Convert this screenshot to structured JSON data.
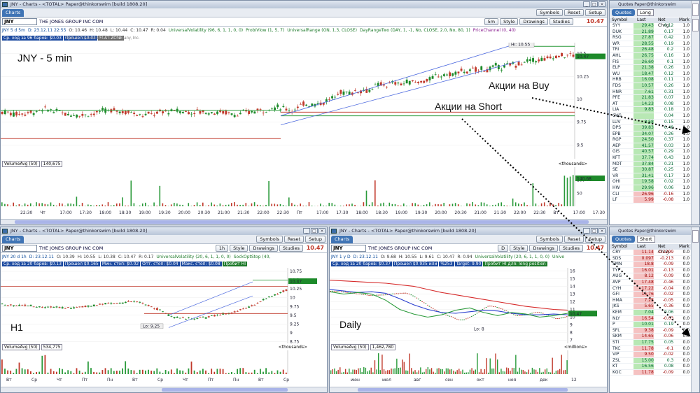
{
  "main_chart": {
    "window_title": "JNY - Charts - <TOTAL> Paper@thinkorswim [build 1808.20]",
    "tab": "Charts",
    "symbol": "JNY",
    "company": "THE JONES GROUP INC COM",
    "last_price": "10.47",
    "change": "+0.32%",
    "toolbar": {
      "symbols": "Symbols",
      "reset": "Reset",
      "setup": "Setup"
    },
    "chart_controls": {
      "timeframe": "5m",
      "style": "Style",
      "drawings": "Drawings",
      "studies": "Studies"
    },
    "studies": [
      "JNY 5 d 5m",
      "D: 23.12.11 22:55",
      "O: 10.46",
      "H: 10.48",
      "L: 10.44",
      "C: 10.47",
      "R: 0.04",
      "UniversalVolatility (96, 6, 1, 1, 0, 0)",
      "ProbIVlow (1, 5, 7)",
      "UniversalRange (ON, 1.3, CLOSE)",
      "DayRangeTwo (DAY, 1, -1, No, CLOSE, 2.0, No, 80, 1)",
      "PriceChannel (0, 40)"
    ],
    "info_badges": [
      "Ср. ход за 96 баров: $0.03",
      "Прошел $0.04",
      "FLAT ZONE"
    ],
    "copyright": "2011 © TD Ameritrade IP Company, Inc.",
    "annotation": "JNY - 5 min",
    "callout_buy": "Акции на Buy",
    "callout_short": "Акции на Short",
    "hi_label": "Hi: 10.55",
    "price_axis": [
      "10.5",
      "10.25",
      "10",
      "9.75",
      "9.5"
    ],
    "price_tag": "10.47",
    "volume_header": "VolumeAvg (50)",
    "volume_value": "140,675",
    "volume_units": "<thousands>",
    "volume_axis": [
      "100",
      "50"
    ],
    "volume_tag": "140.68",
    "time_axis": [
      "22:30",
      "Чт",
      "17:00",
      "17:30",
      "18:00",
      "18:30",
      "19:00",
      "19:30",
      "20:00",
      "20:30",
      "21:00",
      "21:30",
      "22:00",
      "22:30",
      "Пт",
      "17:00",
      "17:30",
      "18:00",
      "18:30",
      "19:00",
      "19:30",
      "20:00",
      "20:30",
      "21:00",
      "21:30",
      "22:00",
      "22:30",
      "Вт",
      "17:00",
      "17:30"
    ]
  },
  "h1_chart": {
    "window_title": "JNY - Charts - <TOTAL> Paper@thinkorswim [build 1808.20]",
    "tab": "Charts",
    "symbol": "JNY",
    "company": "THE JONES GROUP INC COM",
    "last_price": "10.47",
    "toolbar": {
      "symbols": "Symbols",
      "reset": "Reset",
      "setup": "Setup"
    },
    "chart_controls": {
      "timeframe": "1h",
      "style": "Style",
      "drawings": "Drawings",
      "studies": "Studies"
    },
    "studies": [
      "JNY 20 d 1h",
      "D: 23.12.11",
      "O: 10.39",
      "H: 10.55",
      "L: 10.38",
      "C: 10.47",
      "R: 0.17",
      "UniversalVolatility (20, 6, 1, 1, 0, 0)",
      "SockOptStop (40,"
    ],
    "info_badges": [
      "Ср. ход за 20 баров: $0.13",
      "Прошел $0.165",
      "Мин. стоп: $0.02",
      "Опт. стоп: $0.04",
      "Макс. стоп: $0.08",
      "Пробит HI"
    ],
    "annotation": "H1",
    "lo_label": "Lo: 9.25",
    "price_axis": [
      "10.75",
      "10.5",
      "10.25",
      "10",
      "9.75",
      "9.5",
      "9.25",
      "9",
      "8.75"
    ],
    "price_tag": "10.47",
    "volume_header": "VolumeAvg (50)",
    "volume_value": "534,775",
    "volume_units": "<thousands>",
    "time_axis": [
      "Вт",
      "Ср",
      "Чт",
      "Пт",
      "Пн",
      "Вт",
      "Ср",
      "Чт",
      "Пт",
      "Пн",
      "Вт",
      "Ср"
    ]
  },
  "daily_chart": {
    "window_title": "JNY - Charts - <TOTAL> Paper@thinkorswim [build 1808.20]",
    "tab": "Charts",
    "symbol": "JNY",
    "company": "THE JONES GROUP INC COM",
    "last_price": "10.47",
    "toolbar": {
      "symbols": "Symbols",
      "reset": "Reset",
      "setup": "Setup"
    },
    "chart_controls": {
      "timeframe": "D",
      "style": "Style",
      "drawings": "Drawings",
      "studies": "Studies"
    },
    "studies": [
      "JNY 1 y D",
      "D: 23.12.11",
      "O: 9.68",
      "H: 10.55",
      "L: 9.61",
      "C: 10.47",
      "R: 0.94",
      "UniversalVolatility (20, 6, 1, 1, 0, 0)",
      "Unive"
    ],
    "info_badges": [
      "Ср. ход за 20 баров: $0.37",
      "Прошел $0.935 или",
      "%253",
      "Target: 9.90",
      "Пробит HI для: long position"
    ],
    "annotation": "Daily",
    "lo_label": "Lo: 8",
    "price_axis": [
      "16",
      "15",
      "14",
      "13",
      "12",
      "11",
      "10",
      "9",
      "8",
      "7"
    ],
    "price_tag": "10.47",
    "volume_header": "VolumeAvg (50)",
    "volume_value": "1,462,780",
    "volume_units": "<millions>",
    "time_axis": [
      "июн",
      "июл",
      "авг",
      "сен",
      "окт",
      "ноя",
      "дек",
      "12"
    ]
  },
  "quotes_long": {
    "header": "Quotes Paper@thinkorswim",
    "tab": "Quotes",
    "list": "Long",
    "columns": [
      "Symbol",
      "Last",
      "Net Chng",
      "Mark"
    ],
    "rows": [
      [
        "SYY",
        "29.43",
        "0.12",
        "1.0"
      ],
      [
        "DUK",
        "21.89",
        "0.17",
        "1.0"
      ],
      [
        "RSG",
        "27.87",
        "0.42",
        "1.0"
      ],
      [
        "WR",
        "28.55",
        "0.19",
        "1.0"
      ],
      [
        "TRI",
        "26.48",
        "0.2",
        "1.0"
      ],
      [
        "AHL",
        "26.75",
        "0.16",
        "1.0"
      ],
      [
        "FIS",
        "26.60",
        "0.1",
        "1.0"
      ],
      [
        "ELP",
        "21.38",
        "0.26",
        "1.0"
      ],
      [
        "WU",
        "18.47",
        "0.12",
        "1.0"
      ],
      [
        "HRB",
        "16.08",
        "0.11",
        "1.0"
      ],
      [
        "FDS",
        "10.57",
        "0.26",
        "1.0"
      ],
      [
        "HNR",
        "7.61",
        "0.31",
        "1.0"
      ],
      [
        "PFE",
        "21.83",
        "0.07",
        "1.0"
      ],
      [
        "AT",
        "14.23",
        "0.08",
        "1.0"
      ],
      [
        "LIA",
        "9.83",
        "0.18",
        "1.0"
      ],
      [
        "CVG",
        "",
        "0.04",
        "1.0"
      ],
      [
        "LUV",
        "8.58",
        "0.15",
        "1.0"
      ],
      [
        "DPS",
        "39.83",
        "0.48",
        "1.0"
      ],
      [
        "EPB",
        "34.07",
        "0.26",
        "1.0"
      ],
      [
        "RGP",
        "24.50",
        "0.37",
        "1.0"
      ],
      [
        "AEP",
        "41.57",
        "0.03",
        "1.0"
      ],
      [
        "GIS",
        "40.57",
        "0.29",
        "1.0"
      ],
      [
        "KFT",
        "37.74",
        "0.43",
        "1.0"
      ],
      [
        "MDT",
        "37.84",
        "0.21",
        "1.0"
      ],
      [
        "SE",
        "30.87",
        "0.25",
        "1.0"
      ],
      [
        "VR",
        "31.41",
        "0.17",
        "1.0"
      ],
      [
        "OHI",
        "19.58",
        "0.02",
        "1.0"
      ],
      [
        "HW",
        "29.96",
        "0.06",
        "1.0"
      ],
      [
        "CLI",
        "26.96",
        "-0.16",
        "1.0"
      ],
      [
        "LF",
        "5.99",
        "-0.08",
        "1.0"
      ]
    ]
  },
  "quotes_short": {
    "header": "Quotes Paper@thinkorswim",
    "tab": "Quotes",
    "list": "Short",
    "columns": [
      "Symbol",
      "Last",
      "Net Chng",
      "Mark"
    ],
    "rows": [
      [
        "CRY",
        "11.14",
        "-0.1299",
        "0.0"
      ],
      [
        "SDS",
        "0.097",
        "-0.213",
        "0.0"
      ],
      [
        "SMN",
        "18.8",
        "-0.09",
        "0.0"
      ],
      [
        "TYP",
        "16.01",
        "-0.13",
        "0.0"
      ],
      [
        "AUG",
        "8.12",
        "-0.09",
        "0.0"
      ],
      [
        "AVP",
        "17.48",
        "-0.46",
        "0.0"
      ],
      [
        "CYH",
        "17.22",
        "-0.04",
        "0.0"
      ],
      [
        "GFI",
        "15.76",
        "-0.02",
        "0.0"
      ],
      [
        "HMA",
        "7.25",
        "-0.05",
        "0.0"
      ],
      [
        "JKS",
        "5.65",
        "-0.36",
        "0.0"
      ],
      [
        "KEM",
        "7.04",
        "0.06",
        "0.0"
      ],
      [
        "NLY",
        "16.54",
        "-0.03",
        "0.0"
      ],
      [
        "P",
        "10.01",
        "0.19",
        "0.0"
      ],
      [
        "SFL",
        "9.38",
        "-0.09",
        "0.0"
      ],
      [
        "SKM",
        "14.65",
        "-0.06",
        "0.0"
      ],
      [
        "STI",
        "17.75",
        "0.05",
        "0.0"
      ],
      [
        "TKC",
        "11.78",
        "-0.1",
        "0.0"
      ],
      [
        "VIP",
        "9.50",
        "-0.02",
        "0.0"
      ],
      [
        "ZSL",
        "15.00",
        "0.3",
        "0.0"
      ],
      [
        "KT",
        "16.56",
        "0.08",
        "0.0"
      ],
      [
        "KGC",
        "11.78",
        "-0.09",
        "0.0"
      ]
    ]
  }
}
